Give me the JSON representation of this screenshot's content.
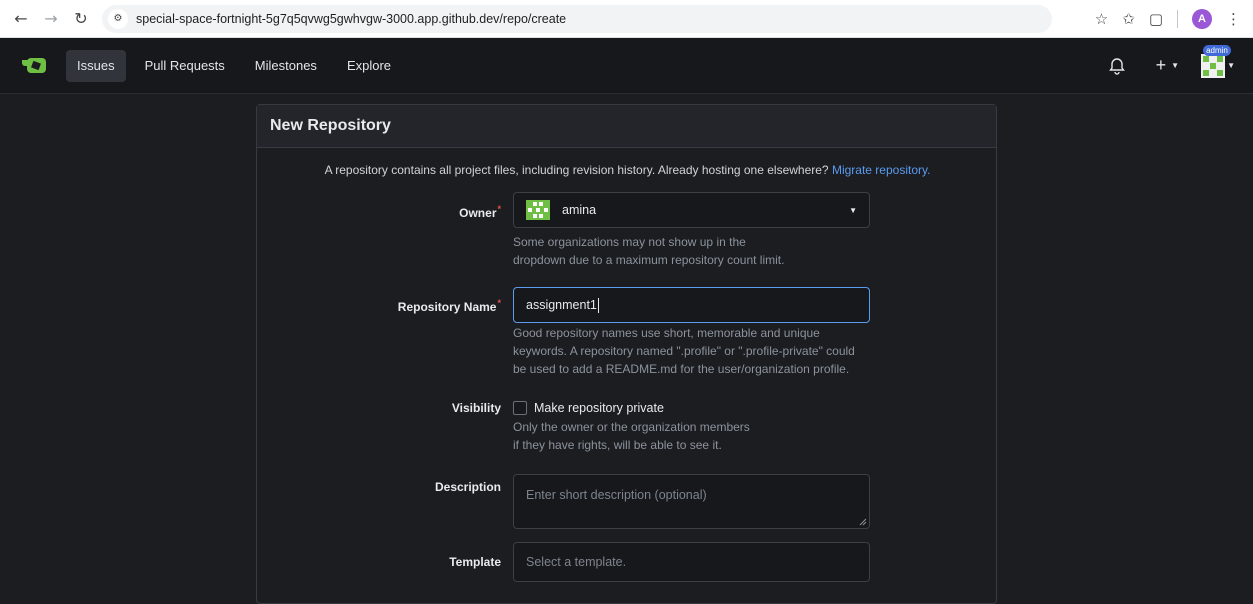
{
  "browser": {
    "url": "special-space-fortnight-5g7q5qvwg5gwhvgw-3000.app.github.dev/repo/create",
    "profile_initial": "A"
  },
  "nav": {
    "items": [
      {
        "label": "Issues",
        "active": true
      },
      {
        "label": "Pull Requests"
      },
      {
        "label": "Milestones"
      },
      {
        "label": "Explore"
      }
    ],
    "admin_badge": "admin"
  },
  "form": {
    "title": "New Repository",
    "intro_text": "A repository contains all project files, including revision history. Already hosting one elsewhere?",
    "intro_link": "Migrate repository.",
    "owner": {
      "label": "Owner",
      "value": "amina",
      "help_line1": "Some organizations may not show up in the",
      "help_line2": "dropdown due to a maximum repository count limit."
    },
    "repo_name": {
      "label": "Repository Name",
      "value": "assignment1",
      "help_line1": "Good repository names use short, memorable and unique",
      "help_line2": "keywords. A repository named \".profile\" or \".profile-private\" could",
      "help_line3": "be used to add a README.md for the user/organization profile."
    },
    "visibility": {
      "label": "Visibility",
      "checkbox_label": "Make repository private",
      "help_line1": "Only the owner or the organization members",
      "help_line2": "if they have rights, will be able to see it."
    },
    "description": {
      "label": "Description",
      "placeholder": "Enter short description (optional)"
    },
    "template": {
      "label": "Template",
      "placeholder": "Select a template."
    }
  },
  "colors": {
    "accent": "#5b9bf0",
    "required": "#e5534b",
    "background": "#1b1d21"
  }
}
